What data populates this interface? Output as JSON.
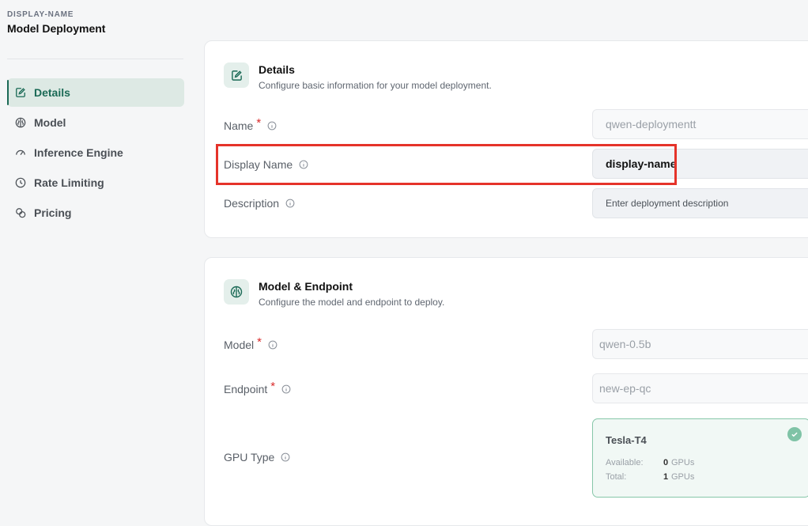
{
  "sidebar": {
    "eyebrow": "DISPLAY-NAME",
    "title": "Model Deployment",
    "items": [
      {
        "label": "Details",
        "icon": "edit-icon",
        "active": true
      },
      {
        "label": "Model",
        "icon": "brain-icon"
      },
      {
        "label": "Inference Engine",
        "icon": "gauge-icon"
      },
      {
        "label": "Rate Limiting",
        "icon": "clock-icon"
      },
      {
        "label": "Pricing",
        "icon": "coins-icon"
      }
    ]
  },
  "details": {
    "title": "Details",
    "subtitle": "Configure basic information for your model deployment.",
    "name_label": "Name",
    "name_value": "qwen-deploymentt",
    "display_name_label": "Display Name",
    "display_name_value": "display-name",
    "description_label": "Description",
    "description_placeholder": "Enter deployment description"
  },
  "model_endpoint": {
    "title": "Model & Endpoint",
    "subtitle": "Configure the model and endpoint to deploy.",
    "model_label": "Model",
    "model_value": "qwen-0.5b",
    "endpoint_label": "Endpoint",
    "endpoint_value": "new-ep-qc",
    "gpu_label": "GPU Type",
    "gpu": {
      "name": "Tesla-T4",
      "available_label": "Available:",
      "available_value": "0",
      "total_label": "Total:",
      "total_value": "1",
      "unit": "GPUs"
    }
  },
  "required_mark": "*",
  "colors": {
    "accent": "#1b6a56",
    "required": "#d92b2b",
    "highlight": "#e5332a"
  }
}
